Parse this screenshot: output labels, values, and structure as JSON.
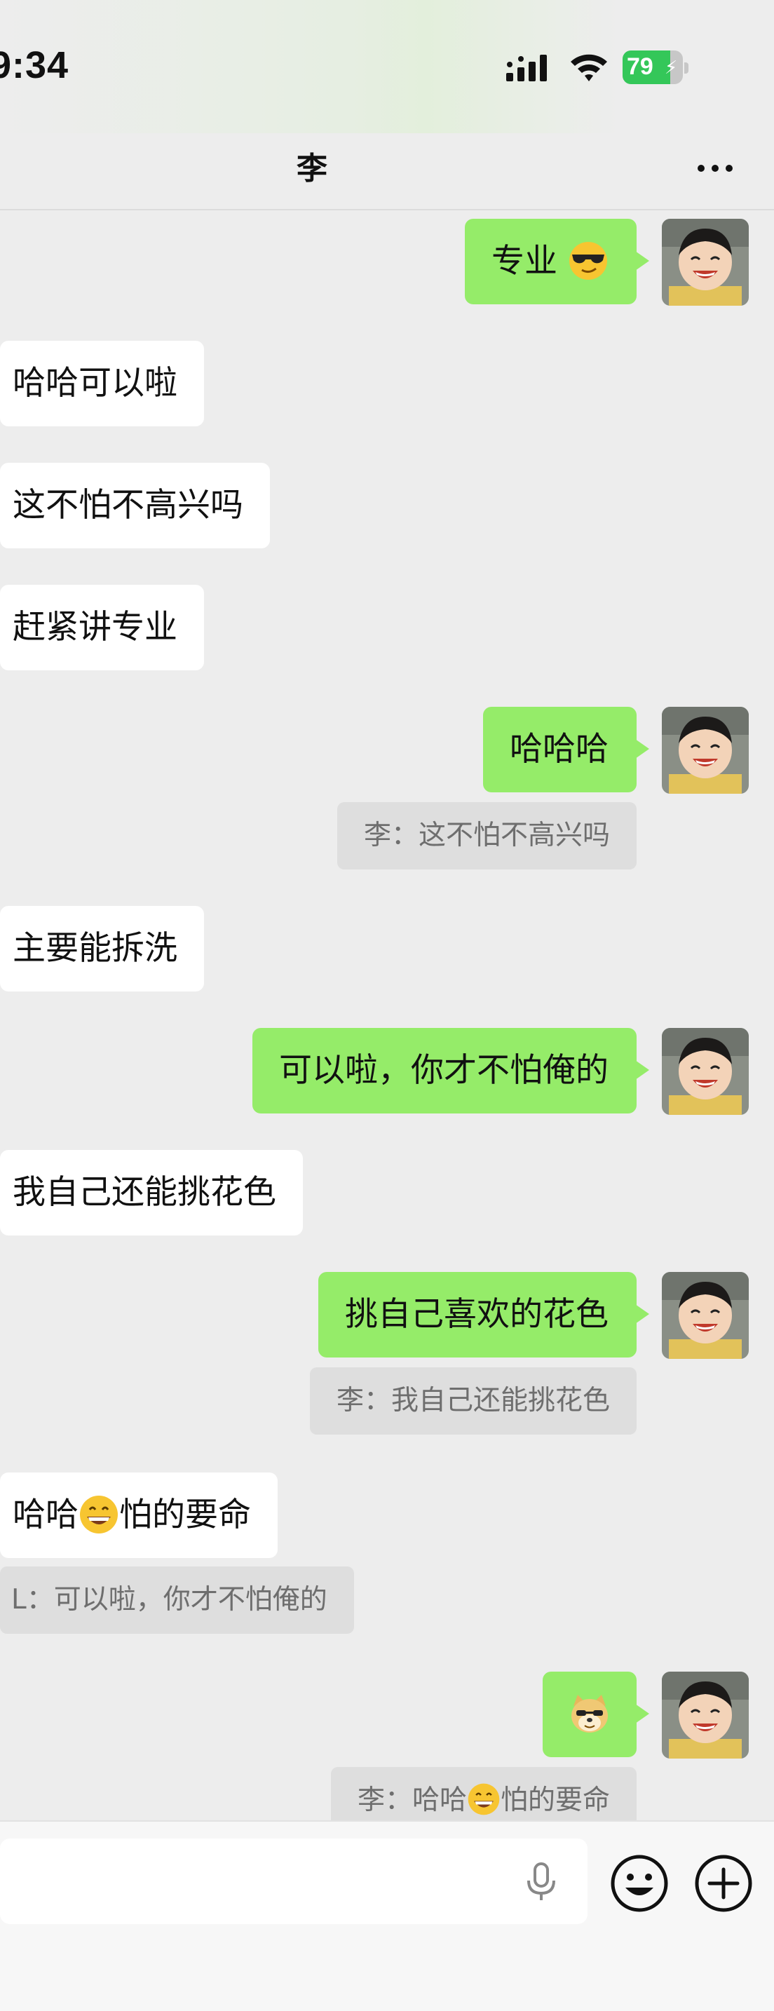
{
  "status_bar": {
    "time": "9:34",
    "battery_level": "79",
    "battery_fraction": 0.79,
    "icons": [
      "cellular-signal-icon",
      "wifi-icon",
      "battery-charging-icon"
    ]
  },
  "header": {
    "title": "李",
    "more_icon": "more-dots-icon"
  },
  "messages": [
    {
      "side": "right",
      "text": "专业",
      "emoji": "sunglasses-face-emoji"
    },
    {
      "side": "left",
      "text": "哈哈可以啦"
    },
    {
      "side": "left",
      "text": "这不怕不高兴吗"
    },
    {
      "side": "left",
      "text": "赶紧讲专业"
    },
    {
      "side": "right",
      "text": "哈哈哈",
      "quote": "李：这不怕不高兴吗"
    },
    {
      "side": "left",
      "text": "主要能拆洗"
    },
    {
      "side": "right",
      "text": "可以啦，你才不怕俺的"
    },
    {
      "side": "left",
      "text": "我自己还能挑花色"
    },
    {
      "side": "right",
      "text": "挑自己喜欢的花色",
      "quote": "李：我自己还能挑花色"
    },
    {
      "side": "left",
      "text_a": "哈哈",
      "emoji": "grinning-face-emoji",
      "text_b": "怕的要命",
      "quote": "L：可以啦，你才不怕俺的"
    },
    {
      "side": "right",
      "emoji": "doge-face-emoji",
      "quote_a": "李：哈哈",
      "quote_emoji": "grinning-face-emoji",
      "quote_b": "怕的要命"
    }
  ],
  "input_bar": {
    "icons": [
      "microphone-icon",
      "emoji-face-icon",
      "plus-circle-icon"
    ]
  },
  "colors": {
    "background": "#ededed",
    "outgoing_bubble": "#95ec69",
    "incoming_bubble": "#ffffff",
    "quote_background": "#dedede",
    "battery_green": "#34c759"
  }
}
